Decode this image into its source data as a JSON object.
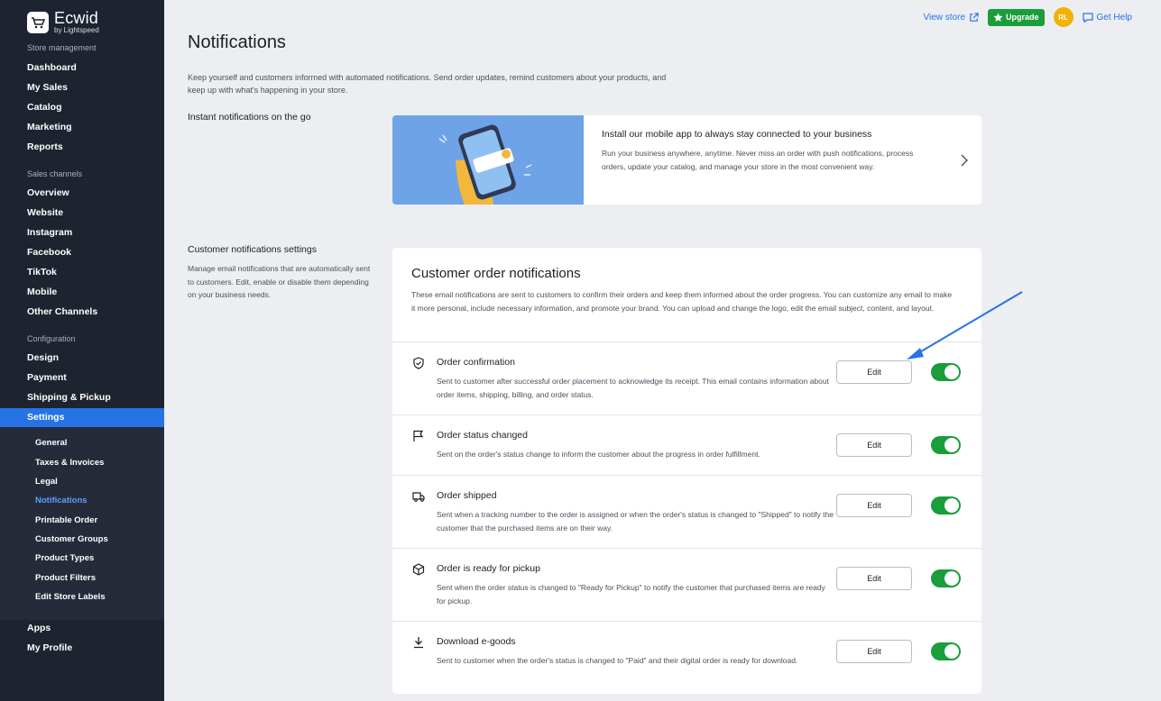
{
  "brand": {
    "name": "Ecwid",
    "sub": "by Lightspeed"
  },
  "sidebar": {
    "groups": [
      {
        "title": "Store management",
        "items": [
          "Dashboard",
          "My Sales",
          "Catalog",
          "Marketing",
          "Reports"
        ]
      },
      {
        "title": "Sales channels",
        "items": [
          "Overview",
          "Website",
          "Instagram",
          "Facebook",
          "TikTok",
          "Mobile",
          "Other Channels"
        ]
      },
      {
        "title": "Configuration",
        "items": [
          "Design",
          "Payment",
          "Shipping & Pickup"
        ]
      }
    ],
    "active": "Settings",
    "subitems": [
      "General",
      "Taxes & Invoices",
      "Legal",
      "Notifications",
      "Printable Order",
      "Customer Groups",
      "Product Types",
      "Product Filters",
      "Edit Store Labels"
    ],
    "current_subitem": "Notifications",
    "bottom_items": [
      "Apps",
      "My Profile"
    ]
  },
  "topbar": {
    "view_store": "View store",
    "upgrade": "Upgrade",
    "avatar": "RL",
    "help": "Get Help"
  },
  "page": {
    "title": "Notifications",
    "desc": "Keep yourself and customers informed with automated notifications. Send order updates, remind customers about your products, and keep up with what's happening in your store."
  },
  "instant": {
    "label": "Instant notifications on the go",
    "promo_title": "Install our mobile app to always stay connected to your business",
    "promo_text": "Run your business anywhere, anytime. Never miss an order with push notifications, process orders, update your catalog, and manage your store in the most convenient way."
  },
  "customer": {
    "label": "Customer notifications settings",
    "desc": "Manage email notifications that are automatically sent to customers. Edit, enable or disable them depending on your business needs.",
    "card_title": "Customer order notifications",
    "card_desc": "These email notifications are sent to customers to confirm their orders and keep them informed about the order progress. You can customize any email to make it more personal, include necessary information, and promote your brand. You can upload and change the logo, edit the email subject, content, and layout.",
    "edit_label": "Edit",
    "rows": [
      {
        "icon": "shield-check-icon",
        "title": "Order confirmation",
        "desc": "Sent to customer after successful order placement to acknowledge its receipt. This email contains information about order items, shipping, billing, and order status.",
        "enabled": true
      },
      {
        "icon": "flag-icon",
        "title": "Order status changed",
        "desc": "Sent on the order's status change to inform the customer about the progress in order fulfillment.",
        "enabled": true
      },
      {
        "icon": "truck-icon",
        "title": "Order shipped",
        "desc": "Sent when a tracking number to the order is assigned or when the order's status is changed to \"Shipped\" to notify the customer that the purchased items are on their way.",
        "enabled": true
      },
      {
        "icon": "box-icon",
        "title": "Order is ready for pickup",
        "desc": "Sent when the order status is changed to \"Ready for Pickup\" to notify the customer that purchased items are ready for pickup.",
        "enabled": true
      },
      {
        "icon": "download-icon",
        "title": "Download e-goods",
        "desc": "Sent to customer when the order's status is changed to \"Paid\" and their digital order is ready for download.",
        "enabled": true
      }
    ]
  },
  "colors": {
    "accent": "#2673e6",
    "toggle_on": "#1a9d3b",
    "sidebar_bg": "#1e2330",
    "upgrade_bg": "#1a9d3b",
    "avatar_bg": "#f2b200"
  }
}
